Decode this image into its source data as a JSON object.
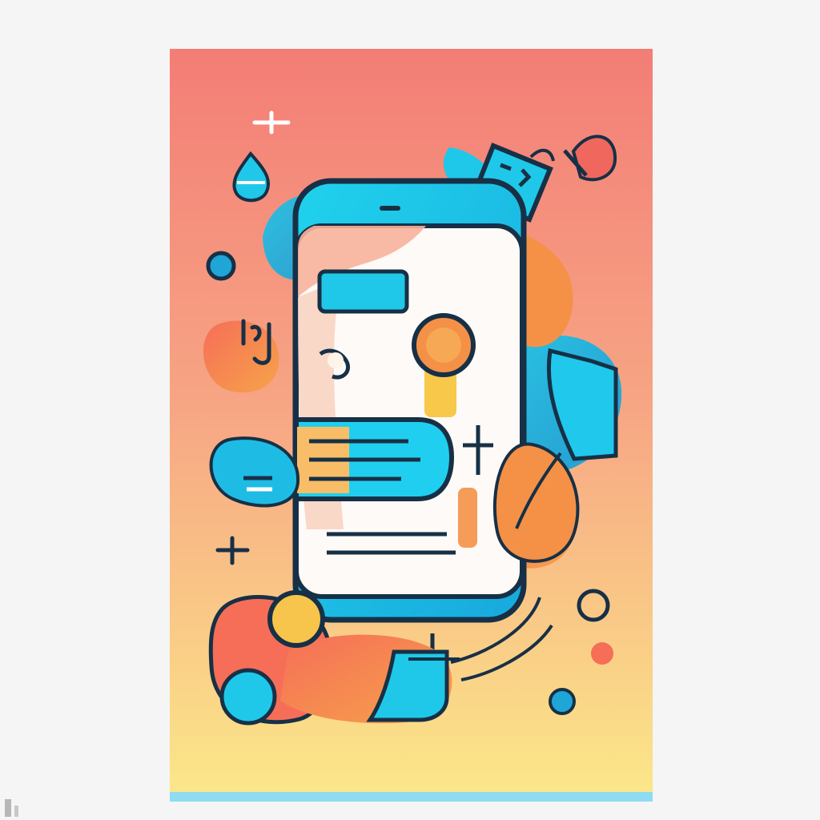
{
  "illustration": {
    "subject": "mobile-app-illustration",
    "style": "flat-gradient-line-art",
    "colors": {
      "page_background": "#f4f5f4",
      "poster_top": "#f37d76",
      "poster_middle": "#f7a684",
      "poster_bottom": "#fbe889",
      "footer_stripe": "#8fdcf2",
      "outline": "#173046",
      "cyan": "#1fc8e8",
      "blue": "#1fa5d6",
      "orange": "#f49147",
      "coral": "#f0675d",
      "yellow": "#f7c54c",
      "screen_white": "#fdfaf7"
    },
    "icons": [
      "phone-icon",
      "search-lens-icon",
      "chat-bubble-icon",
      "speech-bubble-icon",
      "price-tag-icon",
      "music-note-icon",
      "leaf-icon",
      "water-drop-icon",
      "sparkle-plus-icon",
      "shopping-tag-icon"
    ]
  }
}
